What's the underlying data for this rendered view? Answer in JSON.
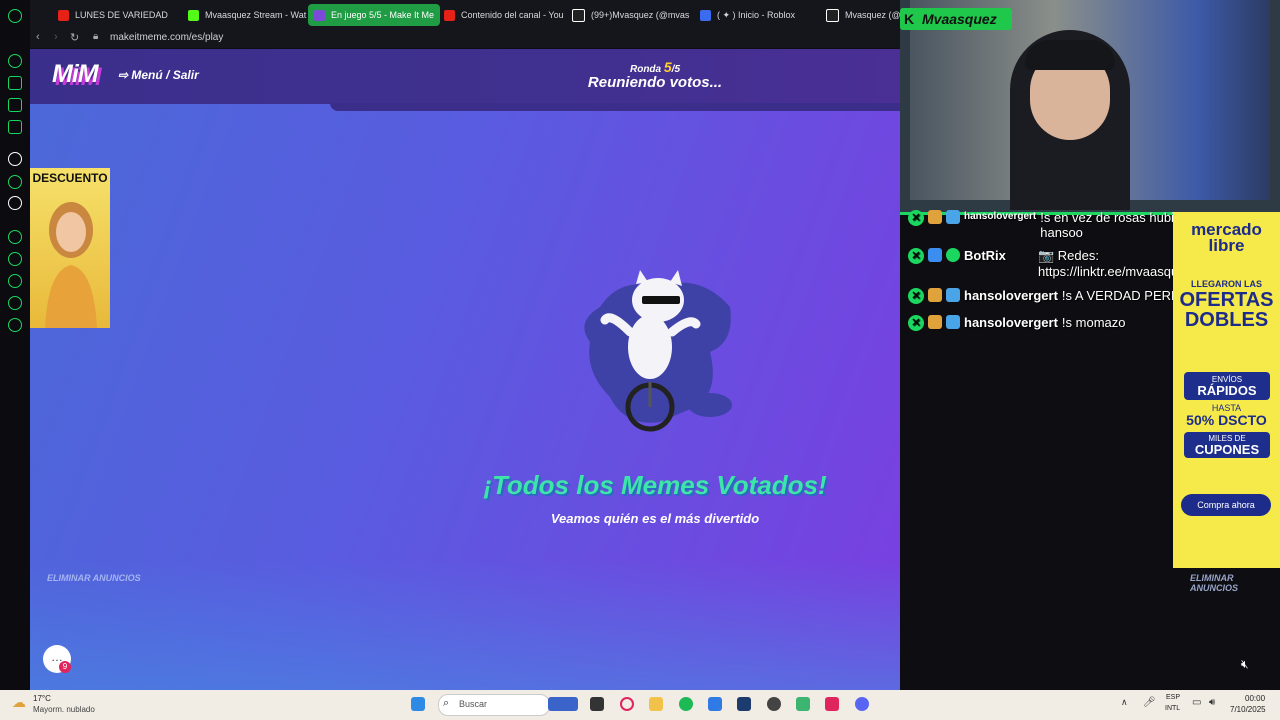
{
  "browser": {
    "tabs": [
      {
        "label": "LUNES DE VARIEDAD",
        "color": "#e62117"
      },
      {
        "label": "Mvaasquez Stream - Wat",
        "color": "#53fc18"
      },
      {
        "label": "En juego 5/5 - Make It Me",
        "color": "#7b4ad9",
        "active": true
      },
      {
        "label": "Contenido del canal - You",
        "color": "#e62117"
      },
      {
        "label": "(99+)Mvasquez (@mvas",
        "color": "#ffffff"
      },
      {
        "label": "( ✦ ) Inicio - Roblox",
        "color": "#3b6cf0"
      },
      {
        "label": "Mvasquez (@m",
        "color": "#ffffff"
      }
    ],
    "url": "makeitmeme.com/es/play"
  },
  "game": {
    "logo": "MiM",
    "menu_label": "Menú / Salir",
    "round_label": "Ronda",
    "round_current": "5",
    "round_total": "/5",
    "status": "Reuniendo votos...",
    "headline": "¡Todos los Memes Votados!",
    "subline": "Veamos quién es el más divertido",
    "remove_ads_left": "ELIMINAR ANUNCIOS",
    "remove_ads_right": "ELIMINAR ANUNCIOS",
    "chat_badge": "9"
  },
  "left_ad": {
    "text": "DESCUENTO"
  },
  "overlay": {
    "streamer": "Mvaasquez",
    "chat": [
      {
        "user": "hansolovergert",
        "message": "!s en vez de rosas hubiera puesto hansoo"
      },
      {
        "user": "BotRix",
        "message": "📷 Redes: https://linktr.ee/mvaasquez"
      },
      {
        "user": "hansolovergert",
        "message": "!s A VERDAD PERDÓN JIJIJA"
      },
      {
        "user": "hansolovergert",
        "message": "!s momazo"
      }
    ]
  },
  "right_ad": {
    "brand_top": "mercado",
    "brand_bottom": "libre",
    "l1": "LLEGARON LAS",
    "l2": "OFERTAS",
    "l3": "DOBLES",
    "b1_small": "ENVÍOS",
    "b1_big": "RÁPIDOS",
    "b2_small": "HASTA",
    "b2_big": "50% DSCTO",
    "b3_small": "MILES DE",
    "b3_big": "CUPONES",
    "button": "Compra ahora"
  },
  "taskbar": {
    "weather_temp": "17°C",
    "weather_desc": "Mayorm. nublado",
    "search_label": "Buscar",
    "lang1": "ESP",
    "lang2": "INTL",
    "time": "00:00",
    "date": "7/10/2025"
  }
}
